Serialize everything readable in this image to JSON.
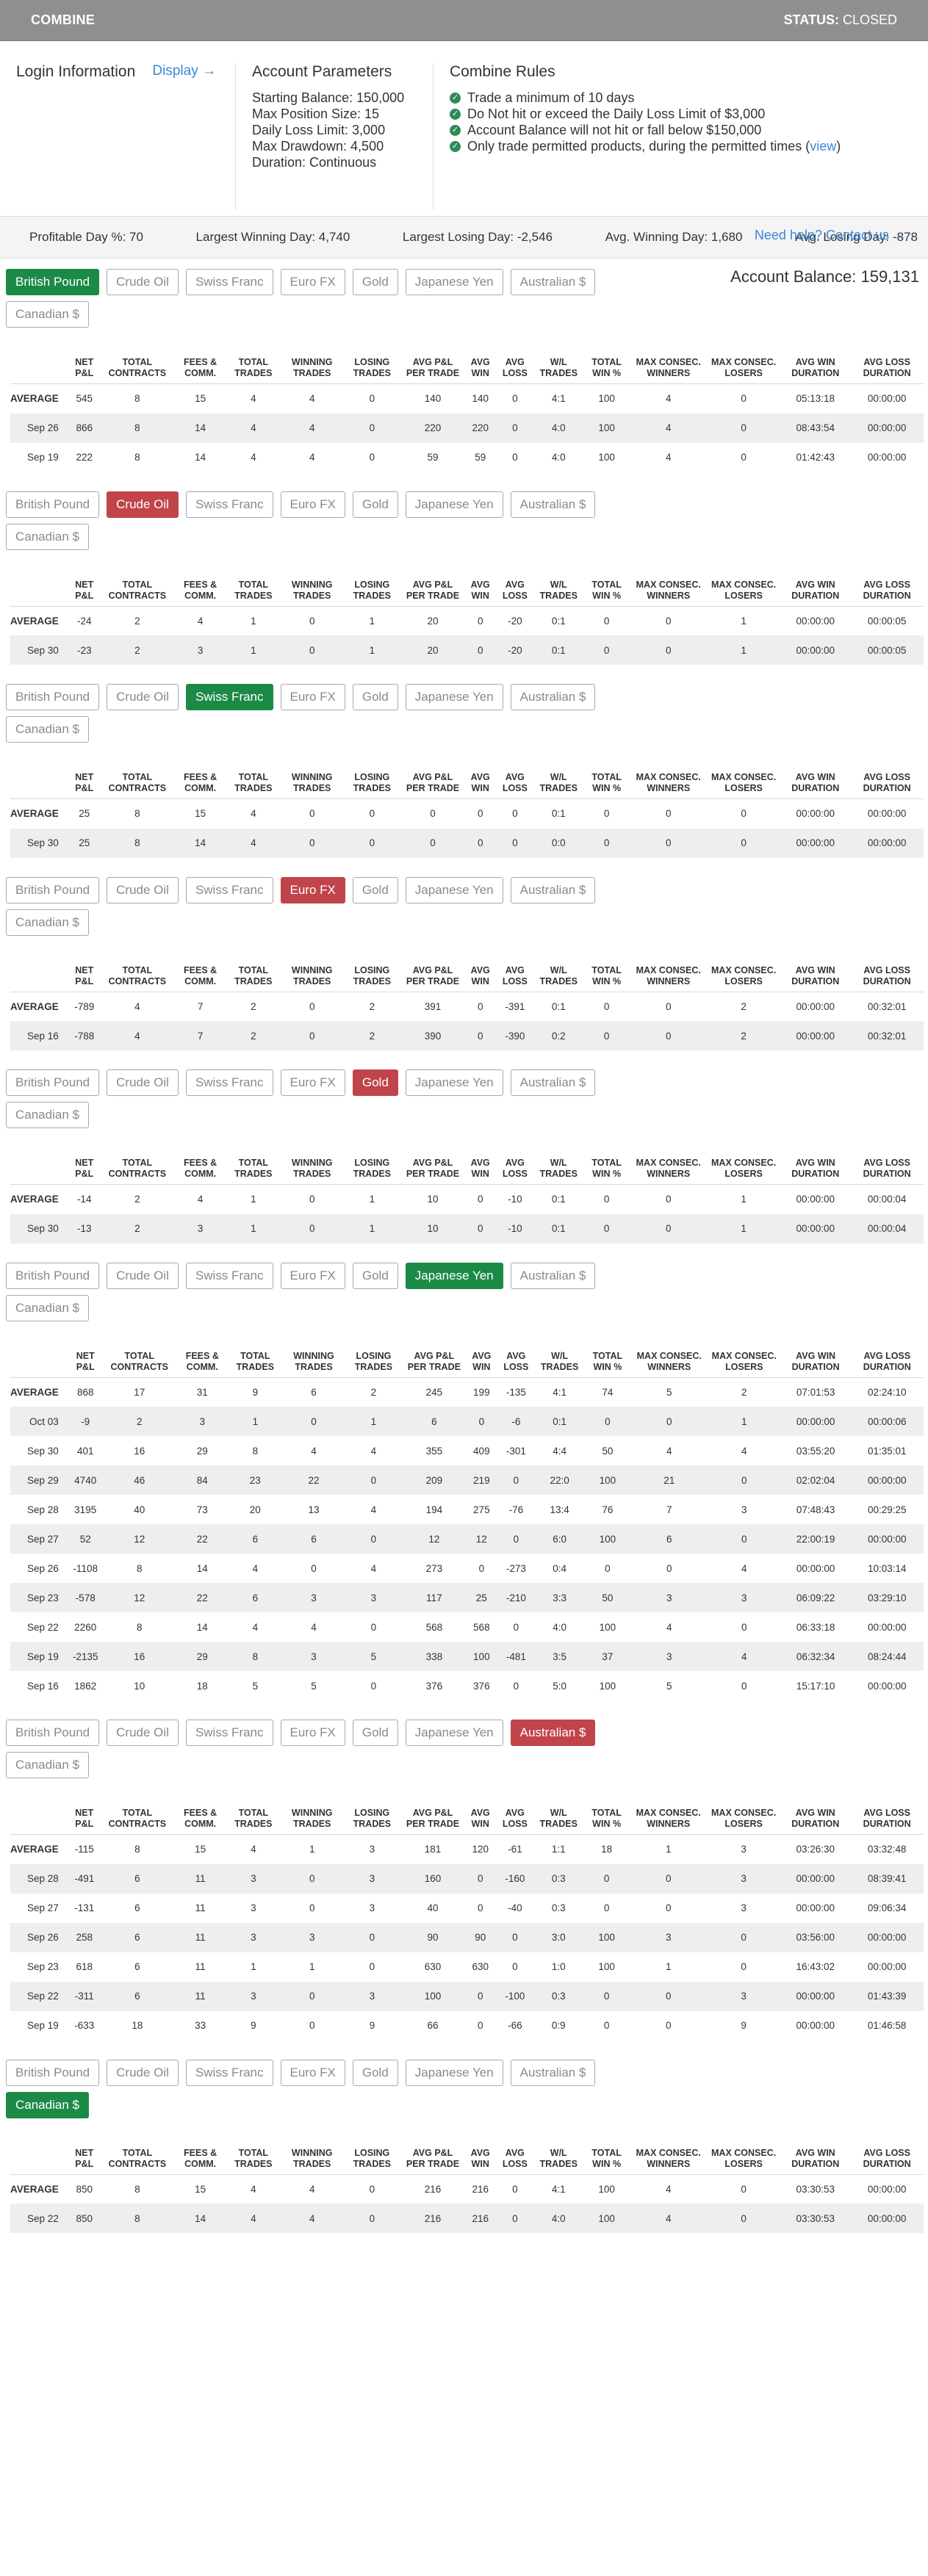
{
  "header": {
    "brand": "COMBINE",
    "status_label": "STATUS:",
    "status_value": "CLOSED"
  },
  "login": {
    "heading": "Login Information",
    "display_link": "Display →"
  },
  "account": {
    "heading": "Account Parameters",
    "params": [
      "Starting Balance: 150,000",
      "Max Position Size: 15",
      "Daily Loss Limit: 3,000",
      "Max Drawdown: 4,500",
      "Duration: Continuous"
    ]
  },
  "rules": {
    "heading": "Combine Rules",
    "items": [
      "Trade a minimum of 10 days",
      "Do Not hit or exceed the Daily Loss Limit of $3,000",
      "Account Balance will not hit or fall below $150,000",
      "Only trade permitted products, during the permitted times ("
    ],
    "view_link": "view",
    "close_paren": ")",
    "help_link": "Need help? Contact us →"
  },
  "stats": [
    "Profitable Day %: 70",
    "Largest Winning Day: 4,740",
    "Largest Losing Day: -2,546",
    "Avg. Winning Day: 1,680",
    "Avg. Losing Day: -878"
  ],
  "balance": "Account Balance: 159,131",
  "products": [
    "British Pound",
    "Crude Oil",
    "Swiss Franc",
    "Euro FX",
    "Gold",
    "Japanese Yen",
    "Australian $",
    "Canadian $"
  ],
  "columns": [
    "",
    "NET P&L",
    "TOTAL CONTRACTS",
    "FEES & COMM.",
    "TOTAL TRADES",
    "WINNING TRADES",
    "LOSING TRADES",
    "AVG P&L PER TRADE",
    "AVG WIN",
    "AVG LOSS",
    "W/L TRADES",
    "TOTAL WIN %",
    "MAX CONSEC. WINNERS",
    "MAX CONSEC. LOSERS",
    "AVG WIN DURATION",
    "AVG LOSS DURATION"
  ],
  "colors": {
    "active_positive": "#1c8a47",
    "active_negative": "#c0444a",
    "header_bar": "#8f8f8f",
    "link": "#3a88d6"
  },
  "sections": [
    {
      "active": 0,
      "state": "green",
      "rows": [
        [
          "AVERAGE",
          "545",
          "8",
          "15",
          "4",
          "4",
          "0",
          "140",
          "140",
          "0",
          "4:1",
          "100",
          "4",
          "0",
          "05:13:18",
          "00:00:00"
        ],
        [
          "Sep 26",
          "866",
          "8",
          "14",
          "4",
          "4",
          "0",
          "220",
          "220",
          "0",
          "4:0",
          "100",
          "4",
          "0",
          "08:43:54",
          "00:00:00"
        ],
        [
          "Sep 19",
          "222",
          "8",
          "14",
          "4",
          "4",
          "0",
          "59",
          "59",
          "0",
          "4:0",
          "100",
          "4",
          "0",
          "01:42:43",
          "00:00:00"
        ]
      ]
    },
    {
      "active": 1,
      "state": "red",
      "rows": [
        [
          "AVERAGE",
          "-24",
          "2",
          "4",
          "1",
          "0",
          "1",
          "20",
          "0",
          "-20",
          "0:1",
          "0",
          "0",
          "1",
          "00:00:00",
          "00:00:05"
        ],
        [
          "Sep 30",
          "-23",
          "2",
          "3",
          "1",
          "0",
          "1",
          "20",
          "0",
          "-20",
          "0:1",
          "0",
          "0",
          "1",
          "00:00:00",
          "00:00:05"
        ]
      ]
    },
    {
      "active": 2,
      "state": "green",
      "rows": [
        [
          "AVERAGE",
          "25",
          "8",
          "15",
          "4",
          "0",
          "0",
          "0",
          "0",
          "0",
          "0:1",
          "0",
          "0",
          "0",
          "00:00:00",
          "00:00:00"
        ],
        [
          "Sep 30",
          "25",
          "8",
          "14",
          "4",
          "0",
          "0",
          "0",
          "0",
          "0",
          "0:0",
          "0",
          "0",
          "0",
          "00:00:00",
          "00:00:00"
        ]
      ]
    },
    {
      "active": 3,
      "state": "red",
      "rows": [
        [
          "AVERAGE",
          "-789",
          "4",
          "7",
          "2",
          "0",
          "2",
          "391",
          "0",
          "-391",
          "0:1",
          "0",
          "0",
          "2",
          "00:00:00",
          "00:32:01"
        ],
        [
          "Sep 16",
          "-788",
          "4",
          "7",
          "2",
          "0",
          "2",
          "390",
          "0",
          "-390",
          "0:2",
          "0",
          "0",
          "2",
          "00:00:00",
          "00:32:01"
        ]
      ]
    },
    {
      "active": 4,
      "state": "red",
      "rows": [
        [
          "AVERAGE",
          "-14",
          "2",
          "4",
          "1",
          "0",
          "1",
          "10",
          "0",
          "-10",
          "0:1",
          "0",
          "0",
          "1",
          "00:00:00",
          "00:00:04"
        ],
        [
          "Sep 30",
          "-13",
          "2",
          "3",
          "1",
          "0",
          "1",
          "10",
          "0",
          "-10",
          "0:1",
          "0",
          "0",
          "1",
          "00:00:00",
          "00:00:04"
        ]
      ]
    },
    {
      "active": 5,
      "state": "green",
      "rows": [
        [
          "AVERAGE",
          "868",
          "17",
          "31",
          "9",
          "6",
          "2",
          "245",
          "199",
          "-135",
          "4:1",
          "74",
          "5",
          "2",
          "07:01:53",
          "02:24:10"
        ],
        [
          "Oct 03",
          "-9",
          "2",
          "3",
          "1",
          "0",
          "1",
          "6",
          "0",
          "-6",
          "0:1",
          "0",
          "0",
          "1",
          "00:00:00",
          "00:00:06"
        ],
        [
          "Sep 30",
          "401",
          "16",
          "29",
          "8",
          "4",
          "4",
          "355",
          "409",
          "-301",
          "4:4",
          "50",
          "4",
          "4",
          "03:55:20",
          "01:35:01"
        ],
        [
          "Sep 29",
          "4740",
          "46",
          "84",
          "23",
          "22",
          "0",
          "209",
          "219",
          "0",
          "22:0",
          "100",
          "21",
          "0",
          "02:02:04",
          "00:00:00"
        ],
        [
          "Sep 28",
          "3195",
          "40",
          "73",
          "20",
          "13",
          "4",
          "194",
          "275",
          "-76",
          "13:4",
          "76",
          "7",
          "3",
          "07:48:43",
          "00:29:25"
        ],
        [
          "Sep 27",
          "52",
          "12",
          "22",
          "6",
          "6",
          "0",
          "12",
          "12",
          "0",
          "6:0",
          "100",
          "6",
          "0",
          "22:00:19",
          "00:00:00"
        ],
        [
          "Sep 26",
          "-1108",
          "8",
          "14",
          "4",
          "0",
          "4",
          "273",
          "0",
          "-273",
          "0:4",
          "0",
          "0",
          "4",
          "00:00:00",
          "10:03:14"
        ],
        [
          "Sep 23",
          "-578",
          "12",
          "22",
          "6",
          "3",
          "3",
          "117",
          "25",
          "-210",
          "3:3",
          "50",
          "3",
          "3",
          "06:09:22",
          "03:29:10"
        ],
        [
          "Sep 22",
          "2260",
          "8",
          "14",
          "4",
          "4",
          "0",
          "568",
          "568",
          "0",
          "4:0",
          "100",
          "4",
          "0",
          "06:33:18",
          "00:00:00"
        ],
        [
          "Sep 19",
          "-2135",
          "16",
          "29",
          "8",
          "3",
          "5",
          "338",
          "100",
          "-481",
          "3:5",
          "37",
          "3",
          "4",
          "06:32:34",
          "08:24:44"
        ],
        [
          "Sep 16",
          "1862",
          "10",
          "18",
          "5",
          "5",
          "0",
          "376",
          "376",
          "0",
          "5:0",
          "100",
          "5",
          "0",
          "15:17:10",
          "00:00:00"
        ]
      ]
    },
    {
      "active": 6,
      "state": "red",
      "rows": [
        [
          "AVERAGE",
          "-115",
          "8",
          "15",
          "4",
          "1",
          "3",
          "181",
          "120",
          "-61",
          "1:1",
          "18",
          "1",
          "3",
          "03:26:30",
          "03:32:48"
        ],
        [
          "Sep 28",
          "-491",
          "6",
          "11",
          "3",
          "0",
          "3",
          "160",
          "0",
          "-160",
          "0:3",
          "0",
          "0",
          "3",
          "00:00:00",
          "08:39:41"
        ],
        [
          "Sep 27",
          "-131",
          "6",
          "11",
          "3",
          "0",
          "3",
          "40",
          "0",
          "-40",
          "0:3",
          "0",
          "0",
          "3",
          "00:00:00",
          "09:06:34"
        ],
        [
          "Sep 26",
          "258",
          "6",
          "11",
          "3",
          "3",
          "0",
          "90",
          "90",
          "0",
          "3:0",
          "100",
          "3",
          "0",
          "03:56:00",
          "00:00:00"
        ],
        [
          "Sep 23",
          "618",
          "6",
          "11",
          "1",
          "1",
          "0",
          "630",
          "630",
          "0",
          "1:0",
          "100",
          "1",
          "0",
          "16:43:02",
          "00:00:00"
        ],
        [
          "Sep 22",
          "-311",
          "6",
          "11",
          "3",
          "0",
          "3",
          "100",
          "0",
          "-100",
          "0:3",
          "0",
          "0",
          "3",
          "00:00:00",
          "01:43:39"
        ],
        [
          "Sep 19",
          "-633",
          "18",
          "33",
          "9",
          "0",
          "9",
          "66",
          "0",
          "-66",
          "0:9",
          "0",
          "0",
          "9",
          "00:00:00",
          "01:46:58"
        ]
      ]
    },
    {
      "active": 7,
      "state": "green",
      "rows": [
        [
          "AVERAGE",
          "850",
          "8",
          "15",
          "4",
          "4",
          "0",
          "216",
          "216",
          "0",
          "4:1",
          "100",
          "4",
          "0",
          "03:30:53",
          "00:00:00"
        ],
        [
          "Sep 22",
          "850",
          "8",
          "14",
          "4",
          "4",
          "0",
          "216",
          "216",
          "0",
          "4:0",
          "100",
          "4",
          "0",
          "03:30:53",
          "00:00:00"
        ]
      ]
    }
  ]
}
